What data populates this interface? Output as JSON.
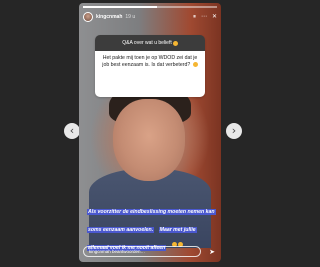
{
  "story": {
    "username": "kingcnmah",
    "timestamp": "19 u",
    "progress": 0.55,
    "pause_icon": "⏸",
    "more_icon": "⋯",
    "close_icon": "✕"
  },
  "qa": {
    "header": "Q&A over wat u belieft",
    "question": "Het pakte mij toen je op WDOD zei dat je job best eenzaam is. Is dat verbeterd?"
  },
  "caption": {
    "line1": "Als voorzitter de eindbeslissing moeten nemen kan soms eenzaam aanvoelen.",
    "line2": "Maar met jullie allemaal voel ik me nooit alleen"
  },
  "reply": {
    "placeholder": "kingcnmah beantwoorden…"
  },
  "navigation": {
    "prev_icon": "‹",
    "next_icon": "›"
  },
  "colors": {
    "background": "#262626",
    "caption_highlight": "#4a58cf",
    "qa_header": "#3c3c3c"
  }
}
